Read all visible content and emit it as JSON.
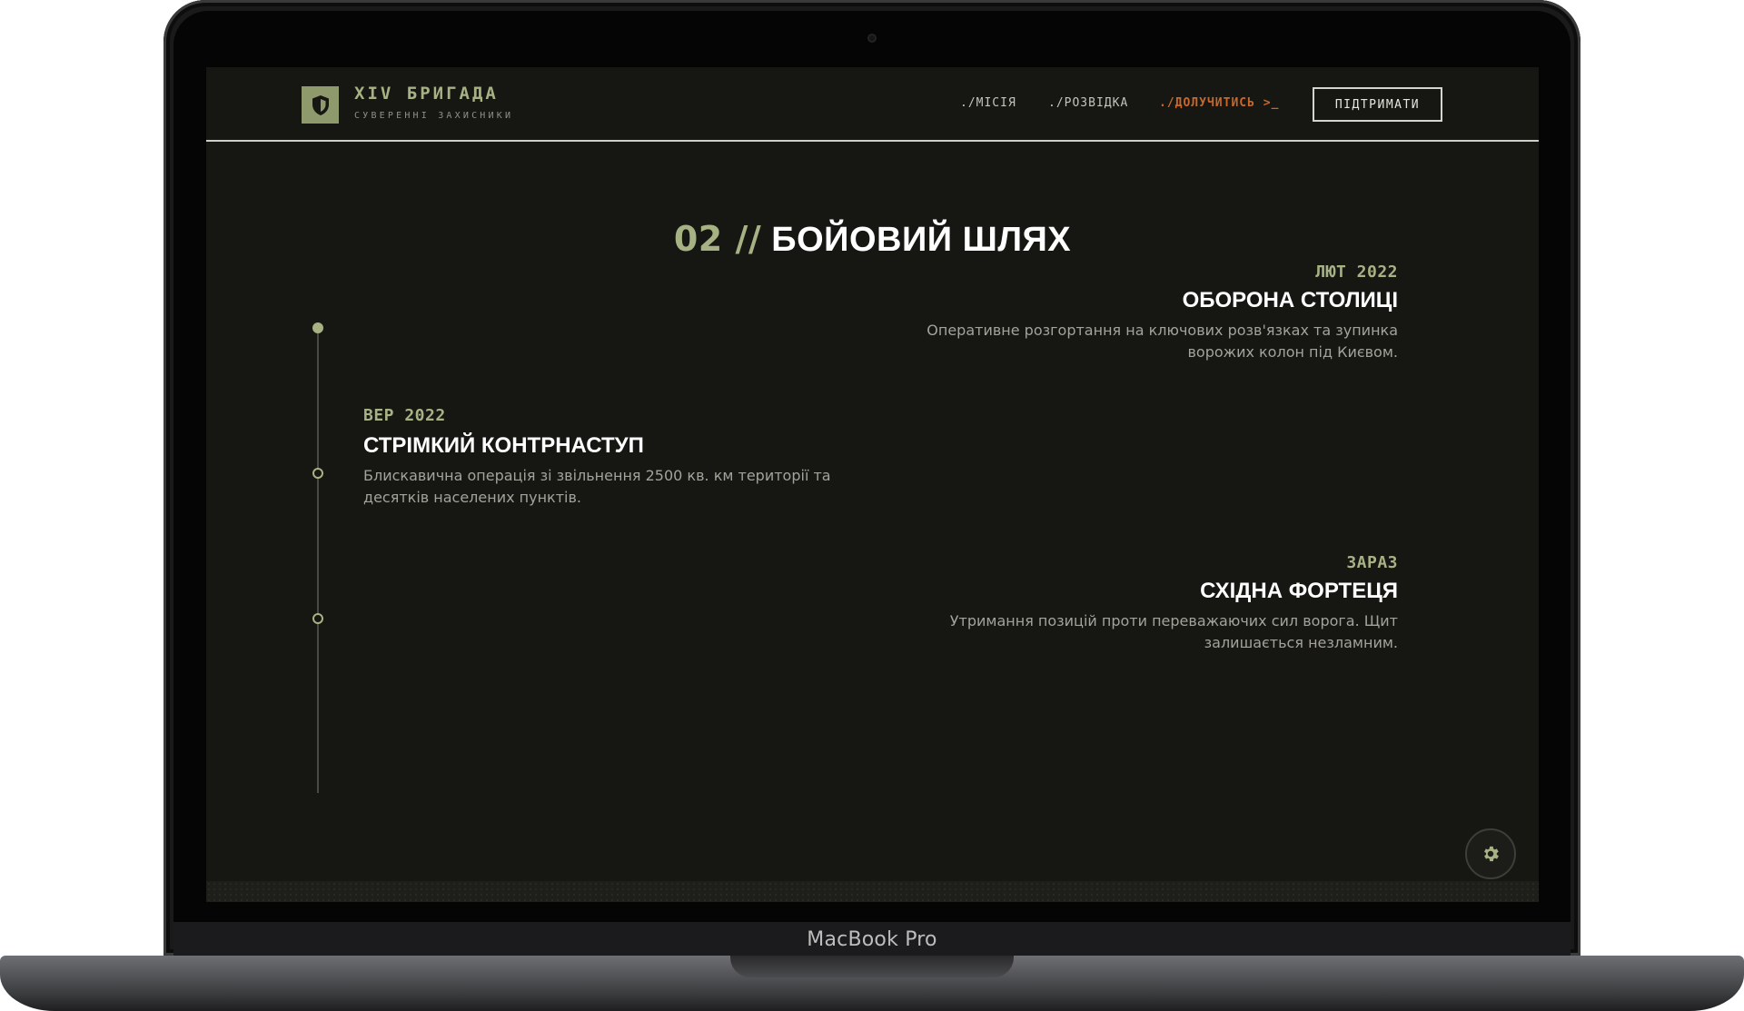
{
  "device": {
    "brand_label": "MacBook Pro"
  },
  "header": {
    "brand_title": "XIV БРИГАДА",
    "brand_subtitle": "СУВЕРЕННІ ЗАХИСНИКИ",
    "nav": [
      {
        "label": "./МІСІЯ",
        "active": false
      },
      {
        "label": "./РОЗВІДКА",
        "active": false
      },
      {
        "label": "./ДОЛУЧИТИСЬ >_",
        "active": true
      }
    ],
    "support_label": "ПІДТРИМАТИ",
    "logo_icon": "shield-icon"
  },
  "section": {
    "number": "02 //",
    "title": "БОЙОВИЙ ШЛЯХ"
  },
  "timeline": [
    {
      "date": "ЛЮТ 2022",
      "title": "ОБОРОНА СТОЛИЦІ",
      "description": "Оперативне розгортання на ключових розв'язках та зупинка ворожих колон під Києвом."
    },
    {
      "date": "ВЕР 2022",
      "title": "СТРІМКИЙ КОНТРНАСТУП",
      "description": "Блискавична операція зі звільнення 2500 кв. км території та десятків населених пунктів."
    },
    {
      "date": "ЗАРАЗ",
      "title": "СХІДНА ФОРТЕЦЯ",
      "description": "Утримання позицій проти переважаючих сил ворога. Щит залишається незламним."
    }
  ],
  "colors": {
    "accent": "#a7b284",
    "active_link": "#c8682a",
    "background": "#161613"
  },
  "floating_button_icon": "gear-icon"
}
